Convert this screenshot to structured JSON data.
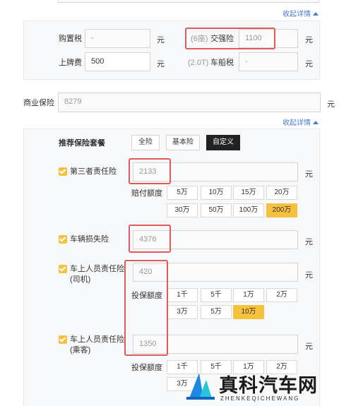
{
  "top": {
    "collapse_link": "收起详情"
  },
  "tax_section": {
    "purchase_tax_label": "购置税",
    "purchase_tax_value": "-",
    "purchase_tax_unit": "元",
    "compulsory_prefix": "(6座)",
    "compulsory_label": "交强险",
    "compulsory_value": "1100",
    "compulsory_unit": "元",
    "plate_fee_label": "上牌费",
    "plate_fee_value": "500",
    "plate_fee_unit": "元",
    "vehicle_tax_prefix": "(2.0T)",
    "vehicle_tax_label": "车船税",
    "vehicle_tax_value": "-",
    "vehicle_tax_unit": "元"
  },
  "commercial": {
    "label": "商业保险",
    "value": "8279",
    "unit": "元",
    "collapse_link": "收起详情"
  },
  "packages": {
    "label": "推荐保险套餐",
    "buttons": [
      "全险",
      "基本险",
      "自定义"
    ],
    "selected": "自定义"
  },
  "third_party": {
    "label": "第三者责任险",
    "value": "2133",
    "unit": "元",
    "sub_label": "赔付额度",
    "options": [
      "5万",
      "10万",
      "15万",
      "20万",
      "30万",
      "50万",
      "100万",
      "200万"
    ],
    "selected": "200万"
  },
  "vehicle_damage": {
    "label": "车辆损失险",
    "value": "4376",
    "unit": "元"
  },
  "driver": {
    "label_line1": "车上人员责任险",
    "label_line2": "(司机)",
    "value": "420",
    "unit": "元",
    "sub_label": "投保额度",
    "options": [
      "1千",
      "5千",
      "1万",
      "2万",
      "3万",
      "5万",
      "10万"
    ],
    "selected": "10万"
  },
  "passenger": {
    "label_line1": "车上人员责任险",
    "label_line2": "(乘客)",
    "value": "1350",
    "unit": "元",
    "sub_label": "投保额度",
    "options": [
      "1千",
      "5千",
      "1万",
      "2万",
      "3万"
    ]
  },
  "watermark": {
    "title": "真科汽车网",
    "subtitle": "ZHENKEQICHEWANG"
  },
  "colors": {
    "accent": "#f6c23e",
    "link": "#4a7bd0",
    "highlight": "#e05a5a"
  }
}
